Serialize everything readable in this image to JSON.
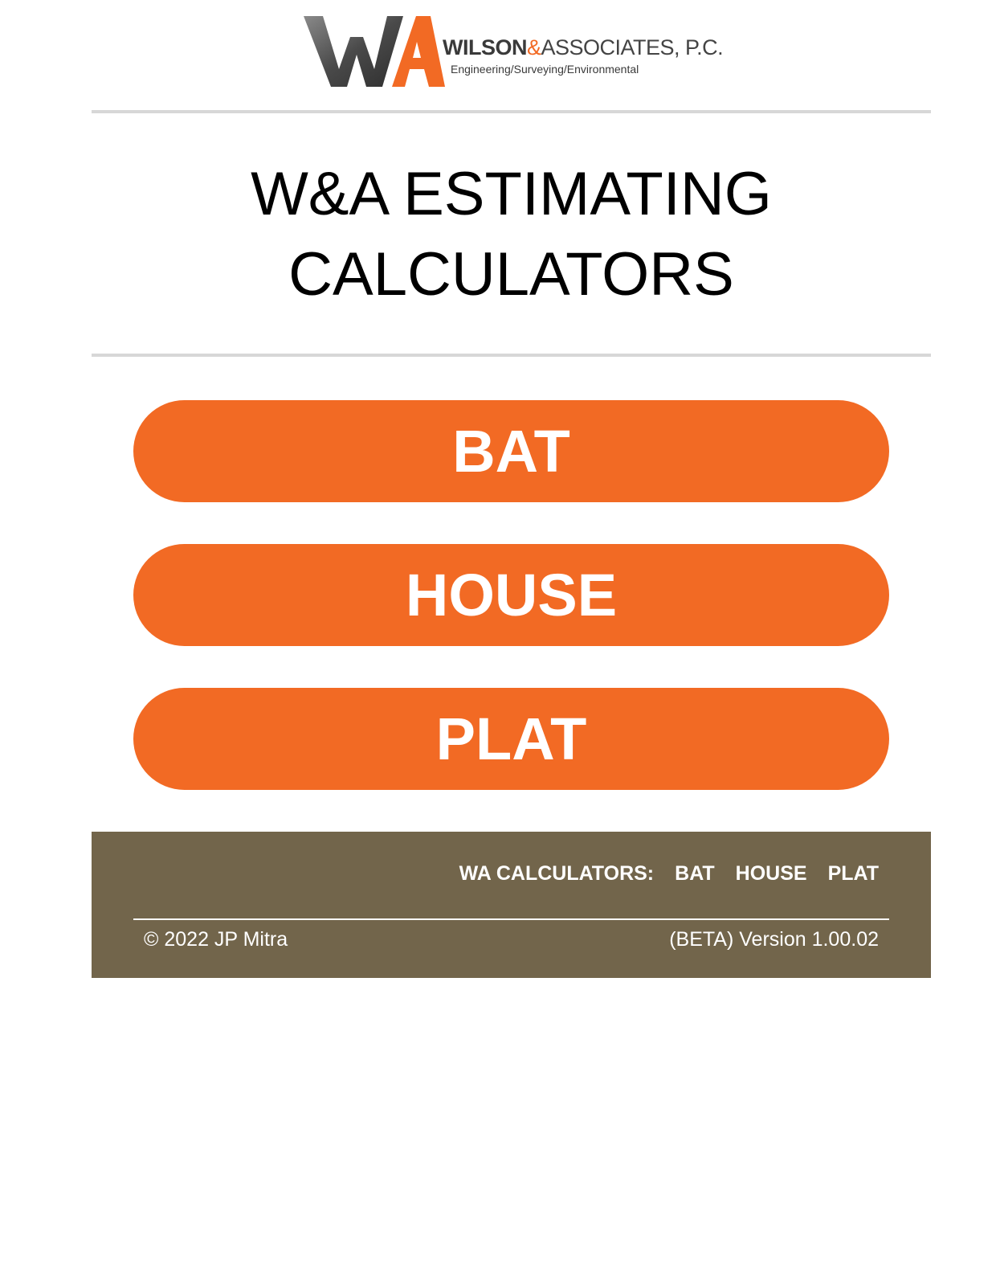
{
  "header": {
    "logo": {
      "monogram": "WA",
      "company_bold": "WILSON",
      "company_amp": "&",
      "company_rest": "ASSOCIATES, P.C.",
      "tagline": "Engineering/Surveying/Environmental",
      "colors": {
        "accent": "#f26a24",
        "gray": "#5a5a5a"
      }
    }
  },
  "page": {
    "title_line1": "W&A ESTIMATING",
    "title_line2": "CALCULATORS"
  },
  "calculators": {
    "bat_label": "BAT",
    "house_label": "HOUSE",
    "plat_label": "PLAT",
    "button_color": "#f26a24"
  },
  "footer": {
    "nav_label": "WA CALCULATORS:",
    "nav_links": [
      "BAT",
      "HOUSE",
      "PLAT"
    ],
    "copyright": "© 2022 JP Mitra",
    "version": "(BETA) Version 1.00.02",
    "background_color": "#72654b"
  }
}
